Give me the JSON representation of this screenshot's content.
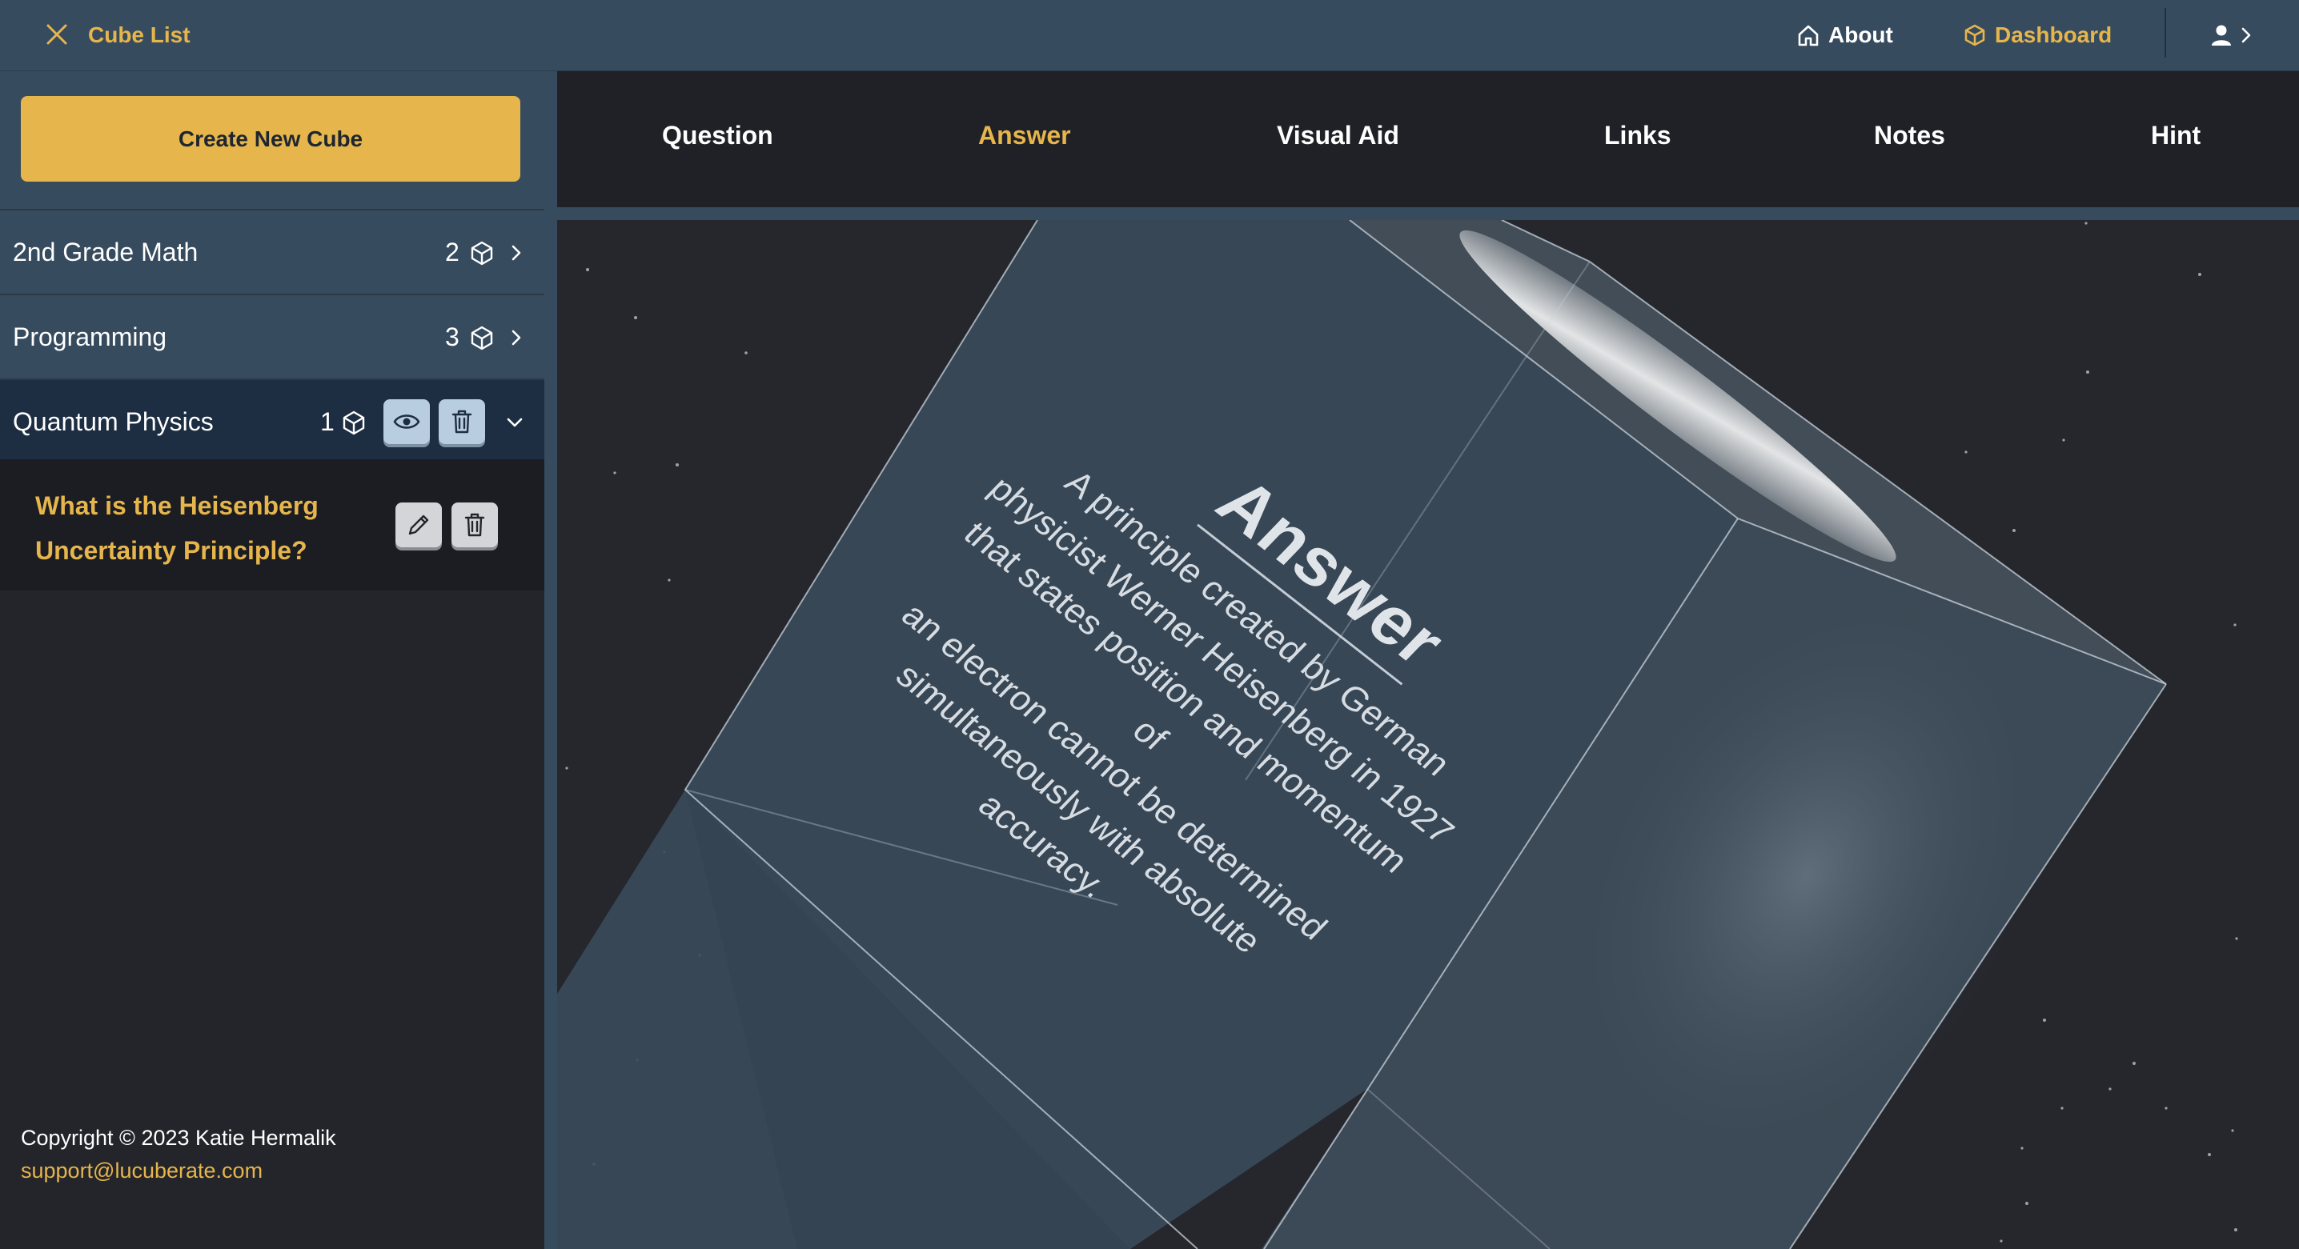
{
  "header": {
    "title": "Cube List",
    "nav": {
      "about": "About",
      "dashboard": "Dashboard"
    },
    "accent_color": "#e6b54c",
    "bar_color": "#374b5e",
    "icons": [
      "close-icon",
      "home-icon",
      "cube-icon",
      "user-icon",
      "chevron-right-icon"
    ]
  },
  "sidebar": {
    "create_button": "Create New Cube",
    "decks": [
      {
        "name": "2nd Grade Math",
        "count": "2",
        "state": "collapsed"
      },
      {
        "name": "Programming",
        "count": "3",
        "state": "collapsed"
      },
      {
        "name": "Quantum Physics",
        "count": "1",
        "state": "expanded"
      }
    ],
    "cards": [
      {
        "question": "What is the Heisenberg Uncertainty Principle?"
      }
    ],
    "footer": {
      "email": "support@lucuberate.com",
      "copyright": "Copyright © 2023 Katie Hermalik"
    }
  },
  "tabs": [
    {
      "label": "Question",
      "active": false
    },
    {
      "label": "Answer",
      "active": true
    },
    {
      "label": "Visual Aid",
      "active": false
    },
    {
      "label": "Links",
      "active": false
    },
    {
      "label": "Notes",
      "active": false
    },
    {
      "label": "Hint",
      "active": false
    }
  ],
  "cube_face": {
    "heading": "Answer",
    "lines": [
      "A principle created by German",
      "physicist Werner Heisenberg in 1927",
      "that states position and momentum of",
      "an electron cannot be determined",
      "simultaneously with absolute accuracy."
    ]
  }
}
